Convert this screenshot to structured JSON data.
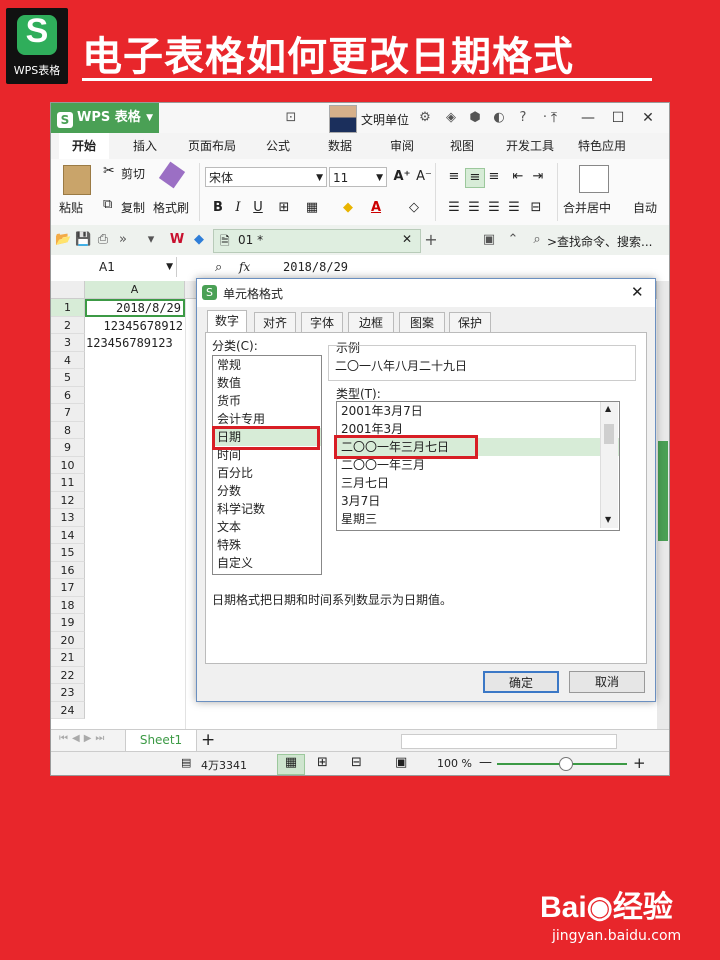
{
  "banner": {
    "logo_letter": "S",
    "logo_label": "WPS表格",
    "headline": "电子表格如何更改日期格式"
  },
  "app": {
    "name": "WPS 表格",
    "user": "文明单位"
  },
  "menu": [
    "开始",
    "插入",
    "页面布局",
    "公式",
    "数据",
    "审阅",
    "视图",
    "开发工具",
    "特色应用"
  ],
  "ribbon": {
    "paste": "粘贴",
    "cut": "剪切",
    "copy": "复制",
    "format_painter": "格式刷",
    "font_name": "宋体",
    "font_size": "11",
    "merge_center": "合并居中",
    "auto": "自动"
  },
  "quick": {
    "doc_tab": "01 *",
    "search": ">查找命令、搜索..."
  },
  "formula_bar": {
    "name_box": "A1",
    "fx": "fx",
    "value": "2018/8/29"
  },
  "grid": {
    "col_a": "A",
    "rows": [
      "1",
      "2",
      "3",
      "4",
      "5",
      "6",
      "7",
      "8",
      "9",
      "10",
      "11",
      "12",
      "13",
      "14",
      "15",
      "16",
      "17",
      "18",
      "19",
      "20",
      "21",
      "22",
      "23",
      "24"
    ],
    "cells": [
      "2018/8/29",
      "12345678912",
      "123456789123"
    ]
  },
  "sheet": {
    "tab": "Sheet1",
    "add": "+"
  },
  "status": {
    "count": "4万3341",
    "zoom": "100 %"
  },
  "dialog": {
    "title": "单元格格式",
    "tabs": [
      "数字",
      "对齐",
      "字体",
      "边框",
      "图案",
      "保护"
    ],
    "category_label": "分类(C):",
    "categories": [
      "常规",
      "数值",
      "货币",
      "会计专用",
      "日期",
      "时间",
      "百分比",
      "分数",
      "科学记数",
      "文本",
      "特殊",
      "自定义"
    ],
    "sample_label": "示例",
    "sample_value": "二〇一八年八月二十九日",
    "type_label": "类型(T):",
    "types": [
      "2001年3月7日",
      "2001年3月",
      "二〇〇一年三月七日",
      "二〇〇一年三月",
      "三月七日",
      "3月7日",
      "星期三"
    ],
    "description": "日期格式把日期和时间系列数显示为日期值。",
    "ok": "确定",
    "cancel": "取消"
  },
  "watermark": {
    "brand": "Bai◉经验",
    "url": "jingyan.baidu.com"
  },
  "colors": {
    "background": "#e8262b",
    "wps_green": "#4aa055",
    "highlight": "#d81e25"
  }
}
